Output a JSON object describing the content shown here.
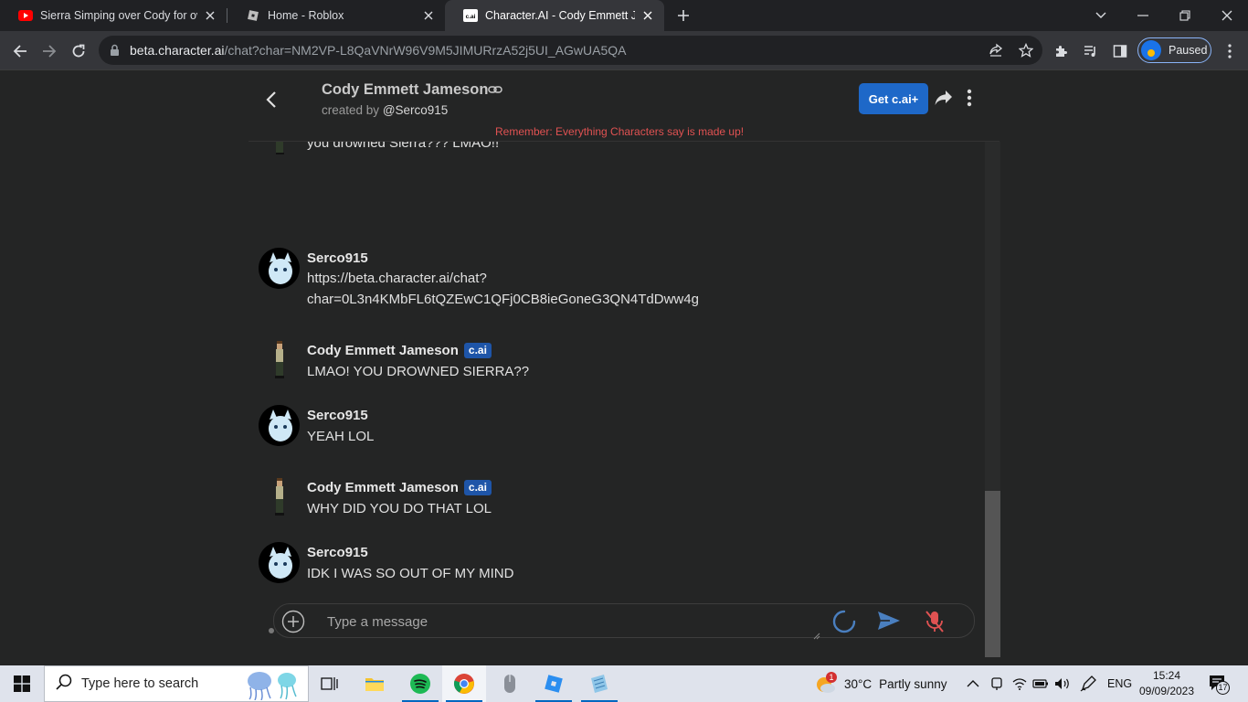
{
  "browser": {
    "tabs": [
      {
        "title": "Sierra Simping over Cody for ove",
        "icon": "youtube-icon"
      },
      {
        "title": "Home - Roblox",
        "icon": "roblox-icon"
      },
      {
        "title": "Character.AI - Cody Emmett Jame",
        "icon": "characterai-icon",
        "favicon_text": "c.ai"
      }
    ],
    "url_host": "beta.character.ai",
    "url_path": "/chat?char=NM2VP-L8QaVNrW96V9M5JIMURrzA52j5UI_AGwUA5QA",
    "profile_label": "Paused"
  },
  "chat": {
    "character_name": "Cody Emmett Jameson",
    "created_by_prefix": "created by",
    "creator": "@Serco915",
    "upgrade_label": "Get c.ai+",
    "reminder": "Remember: Everything Characters say is made up!",
    "badge_label": "c.ai",
    "partial_message": "you drowned Sierra??? LMAO!!",
    "messages": [
      {
        "author": "Serco915",
        "text_lines": [
          "https://beta.character.ai/chat?",
          "char=0L3n4KMbFL6tQZEwC1QFj0CB8ieGoneG3QN4TdDww4g"
        ]
      },
      {
        "author": "Cody Emmett Jameson",
        "text_lines": [
          "LMAO! YOU DROWNED SIERRA??"
        ]
      },
      {
        "author": "Serco915",
        "text_lines": [
          "YEAH LOL"
        ]
      },
      {
        "author": "Cody Emmett Jameson",
        "text_lines": [
          "WHY DID YOU DO THAT LOL"
        ]
      },
      {
        "author": "Serco915",
        "text_lines": [
          "IDK I WAS SO OUT OF MY MIND"
        ]
      }
    ],
    "composer_placeholder": "Type a message"
  },
  "taskbar": {
    "search_placeholder": "Type here to search",
    "weather_temp": "30°C",
    "weather_desc": "Partly sunny",
    "weather_badge": "1",
    "language": "ENG",
    "time": "15:24",
    "date": "09/09/2023",
    "notification_count": "17"
  },
  "colors": {
    "accent": "#1e68c8",
    "reminder": "#e05252",
    "background": "#242525"
  }
}
